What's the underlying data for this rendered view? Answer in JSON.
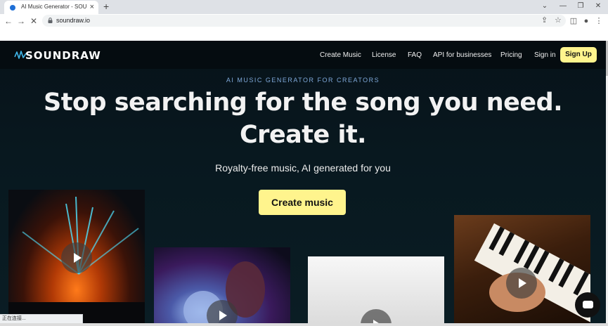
{
  "browser": {
    "tab_title": "AI Music Generator - SOUNDRAW",
    "tab_close": "×",
    "new_tab": "+",
    "url": "soundraw.io",
    "status_text": "正在连接...",
    "icons": [
      "back-icon",
      "forward-icon",
      "stop-icon",
      "lock-icon",
      "share-icon",
      "star-icon",
      "sidebar-icon",
      "profile-icon",
      "menu-icon",
      "minimize-icon",
      "restore-icon",
      "close-icon",
      "chevron-down-icon"
    ]
  },
  "site": {
    "logo": "SOUNDRAW",
    "nav": {
      "create_music": "Create Music",
      "license": "License",
      "faq": "FAQ",
      "api": "API for businesses",
      "pricing": "Pricing",
      "sign_in": "Sign in",
      "sign_up": "Sign Up"
    },
    "hero": {
      "eyebrow": "AI MUSIC GENERATOR FOR CREATORS",
      "headline_line1": "Stop searching for the song you need.",
      "headline_line2": "Create it.",
      "subheading": "Royalty-free music, AI generated for you",
      "cta": "Create music"
    },
    "accent_color": "#fff48d",
    "background_color": "#071219"
  }
}
